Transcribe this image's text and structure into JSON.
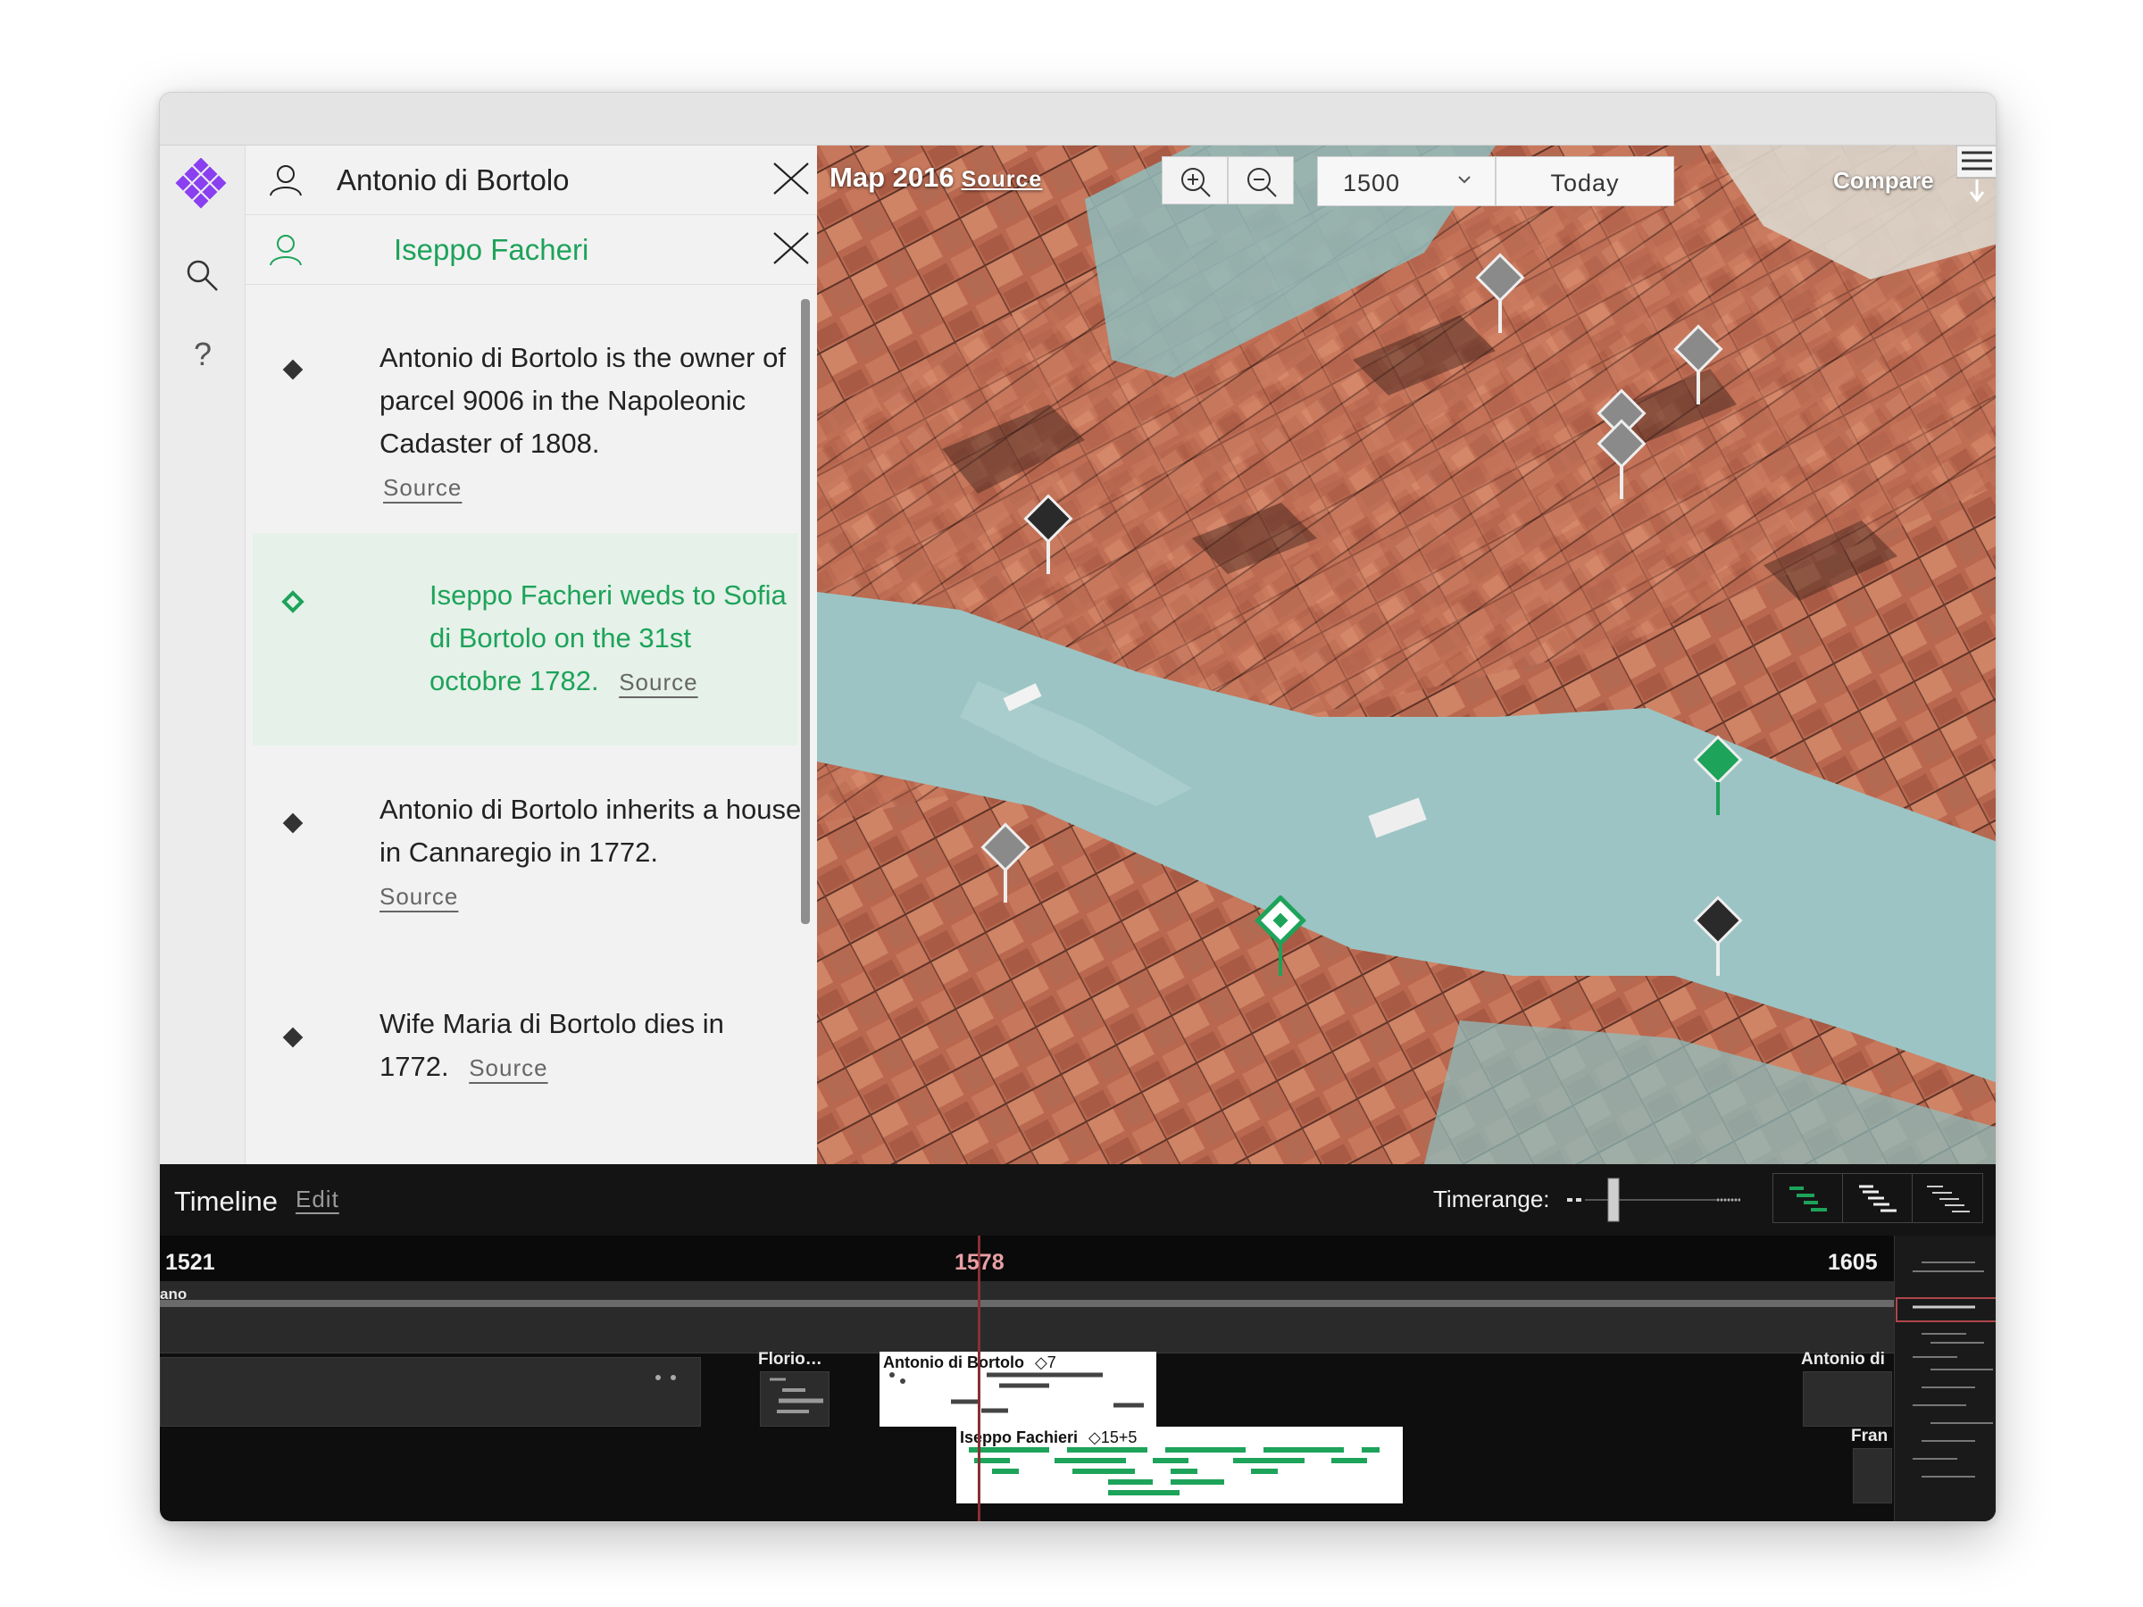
{
  "people": [
    {
      "name": "Antonio di Bortolo",
      "color": "#222222"
    },
    {
      "name": "Iseppo Facheri",
      "color": "#1da35a"
    }
  ],
  "entries": [
    {
      "text": "Antonio di Bortolo is the owner of parcel 9006 in the Napoleonic Cadaster of 1808.",
      "source": "Source",
      "marker": "filled-diamond"
    },
    {
      "text": "Iseppo Facheri weds to Sofia di Bortolo on the 31st octobre 1782.",
      "source": "Source",
      "marker": "hollow-diamond",
      "highlight": true
    },
    {
      "text": "Antonio di Bortolo inherits a house in Cannaregio in 1772.",
      "source": "Source",
      "marker": "filled-diamond"
    },
    {
      "text": "Wife Maria di Bortolo dies in 1772.",
      "source": "Source",
      "marker": "filled-diamond"
    }
  ],
  "map": {
    "title": "Map 2016",
    "source_label": "Source",
    "year_value": "1500",
    "today_label": "Today",
    "compare_label": "Compare"
  },
  "timeline": {
    "title": "Timeline",
    "edit_label": "Edit",
    "timerange_label": "Timerange:",
    "year_start": "1521",
    "year_cursor": "1578",
    "year_end": "1605",
    "band_cut_label": "ano",
    "cards": [
      {
        "name": "Florio…",
        "count": ""
      },
      {
        "name": "Antonio di Bortolo",
        "count": "◇7"
      },
      {
        "name": "Iseppo Fachieri",
        "count": "◇15+5"
      },
      {
        "name": "Antonio di",
        "count": ""
      },
      {
        "name": "Fran",
        "count": ""
      }
    ]
  },
  "colors": {
    "accent_green": "#1da35a",
    "logo_purple": "#8a3ff0",
    "timeline_bg": "#0e0e0e",
    "cursor_red": "#8a2f33"
  }
}
